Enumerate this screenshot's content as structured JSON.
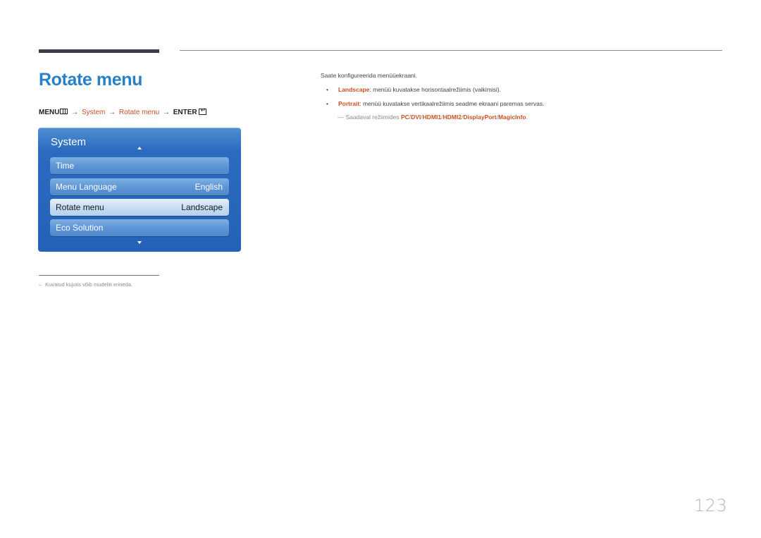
{
  "page": {
    "title": "Rotate menu",
    "page_number": "123"
  },
  "path": {
    "menu_label": "MENU",
    "menu_icon": "menu-icon",
    "arrow": "→",
    "system": "System",
    "rotate_menu": "Rotate menu",
    "enter_label": "ENTER",
    "enter_icon": "enter-icon"
  },
  "osd": {
    "title": "System",
    "up_icon": "triangle-up-icon",
    "down_icon": "triangle-down-icon",
    "items": [
      {
        "label": "Time",
        "value": "",
        "selected": false
      },
      {
        "label": "Menu Language",
        "value": "English",
        "selected": false
      },
      {
        "label": "Rotate menu",
        "value": "Landscape",
        "selected": true
      },
      {
        "label": "Eco Solution",
        "value": "",
        "selected": false
      }
    ]
  },
  "footnote": {
    "dash": "–",
    "text": "Kuvatud kujutis võib mudeliti erineda."
  },
  "content": {
    "intro": "Saate konfigureerida menüüekraani.",
    "bullets": [
      {
        "keyword": "Landscape",
        "text": ": menüü kuvatakse horisontaalrežiimis (vaikimisi)."
      },
      {
        "keyword": "Portrait",
        "text": ": menüü kuvatakse vertikaalrežiimis seadme ekraani paremas servas."
      }
    ],
    "note": {
      "dash": "—",
      "prefix": "Saadaval režiimides ",
      "modes": [
        "PC",
        "DVI",
        "HDMI1",
        "HDMI2",
        "DisplayPort",
        "MagicInfo"
      ],
      "separator": "/",
      "suffix": "."
    }
  },
  "colors": {
    "title_blue": "#2a80c7",
    "keyword_orange": "#c9501f",
    "osd_blue": "#2362b6"
  }
}
